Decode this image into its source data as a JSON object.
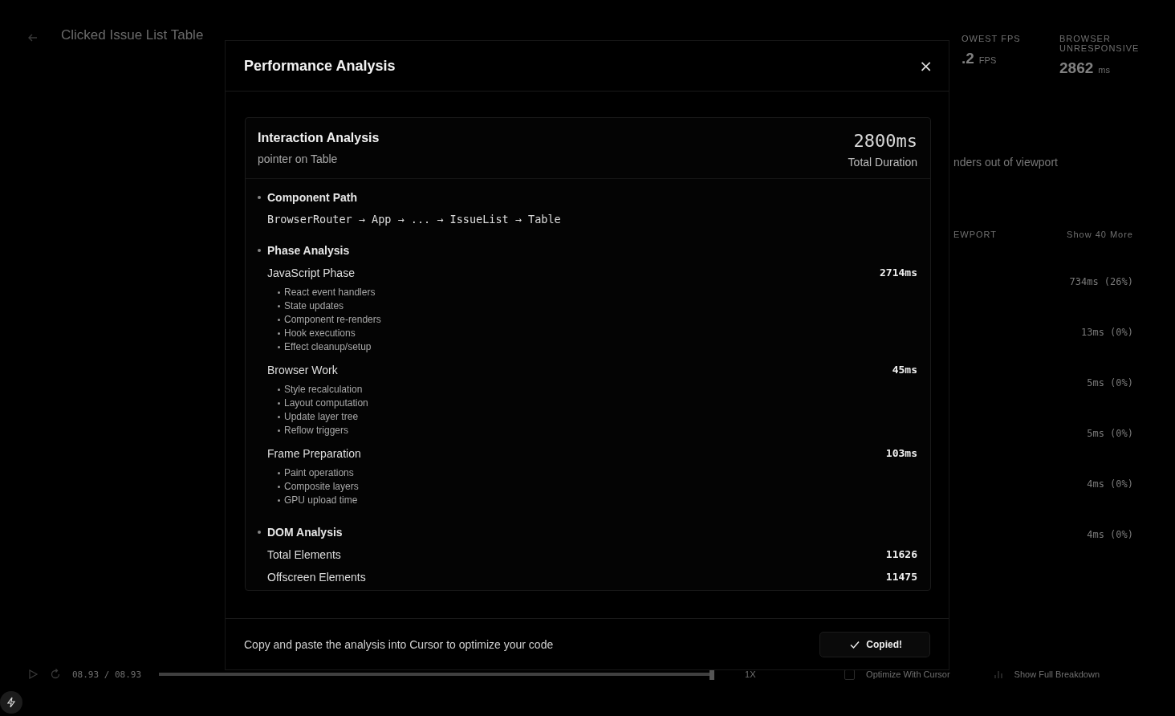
{
  "page": {
    "title": "Clicked Issue List Table",
    "stats": [
      {
        "label": "OWEST FPS",
        "value": ".2",
        "unit": "FPS"
      },
      {
        "label": "BROWSER UNRESPONSIVE",
        "value": "2862",
        "unit": "ms"
      }
    ],
    "panel": {
      "summary": "nders out of viewport",
      "section_label": "EWPORT",
      "show_more": "Show 40 More",
      "rows": [
        "734ms (26%)",
        "13ms (0%)",
        "5ms (0%)",
        "5ms (0%)",
        "4ms (0%)",
        "4ms (0%)"
      ]
    }
  },
  "player": {
    "time": "08.93 / 08.93",
    "level": 1,
    "speed": "1X",
    "optimize": {
      "label": "Optimize With Cursor",
      "checked": false
    },
    "breakdown": "Show Full Breakdown"
  },
  "modal": {
    "title": "Performance Analysis",
    "close": "×",
    "card": {
      "title": "Interaction Analysis",
      "subtitle": "pointer on Table",
      "total": "2800ms",
      "total_label": "Total Duration",
      "sections": [
        {
          "kind": "path",
          "heading": "Component Path",
          "path": "BrowserRouter → App → ... → IssueList → Table"
        },
        {
          "kind": "phases",
          "heading": "Phase Analysis",
          "items": [
            {
              "name": "JavaScript Phase",
              "value": "2714ms",
              "details": [
                "React event handlers",
                "State updates",
                "Component re-renders",
                "Hook executions",
                "Effect cleanup/setup"
              ]
            },
            {
              "name": "Browser Work",
              "value": "45ms",
              "details": [
                "Style recalculation",
                "Layout computation",
                "Update layer tree",
                "Reflow triggers"
              ]
            },
            {
              "name": "Frame Preparation",
              "value": "103ms",
              "details": [
                "Paint operations",
                "Composite layers",
                "GPU upload time"
              ]
            }
          ]
        },
        {
          "kind": "metrics",
          "heading": "DOM Analysis",
          "items": [
            {
              "name": "Total Elements",
              "value": "11626"
            },
            {
              "name": "Offscreen Elements",
              "value": "11475"
            }
          ]
        }
      ]
    },
    "footer": {
      "text": "Copy and paste the analysis into Cursor to optimize your code",
      "button": "Copied!"
    }
  }
}
